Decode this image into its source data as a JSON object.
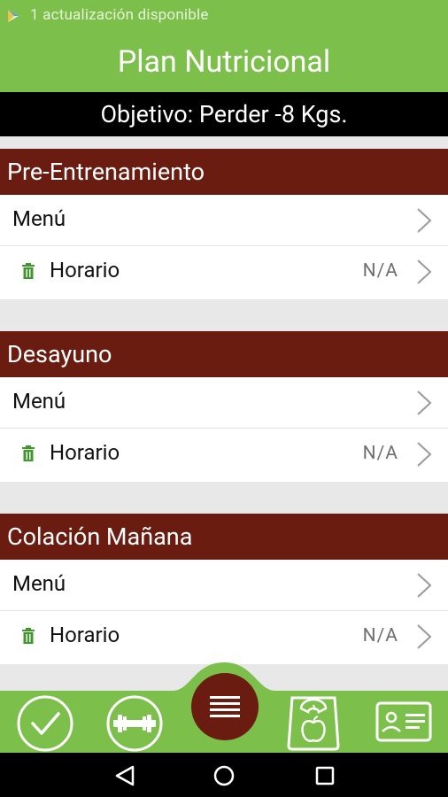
{
  "status_bar": {
    "text": "1 actualización disponible",
    "icon": "play-store-icon"
  },
  "app_bar": {
    "title": "Plan Nutricional"
  },
  "goal_bar": {
    "text": "Objetivo: Perder -8 Kgs."
  },
  "sections": [
    {
      "title": "Pre-Entrenamiento",
      "menu_label": "Menú",
      "schedule_label": "Horario",
      "schedule_value": "N/A"
    },
    {
      "title": "Desayuno",
      "menu_label": "Menú",
      "schedule_label": "Horario",
      "schedule_value": "N/A"
    },
    {
      "title": "Colación Mañana",
      "menu_label": "Menú",
      "schedule_label": "Horario",
      "schedule_value": "N/A"
    }
  ],
  "bottom_nav": {
    "items": [
      {
        "icon": "check-circle-icon"
      },
      {
        "icon": "dumbbell-icon"
      },
      {
        "icon": "menu-icon",
        "active": true
      },
      {
        "icon": "scale-apple-icon"
      },
      {
        "icon": "id-card-icon"
      }
    ]
  },
  "system_nav": {
    "items": [
      "back-icon",
      "home-icon",
      "recents-icon"
    ]
  },
  "colors": {
    "green": "#7cc04b",
    "section_header": "#6a1c10",
    "goal_bar": "#000000",
    "center_button": "#6a1c10",
    "trash_icon": "#3d9a2a",
    "background": "#e8e8e8"
  }
}
